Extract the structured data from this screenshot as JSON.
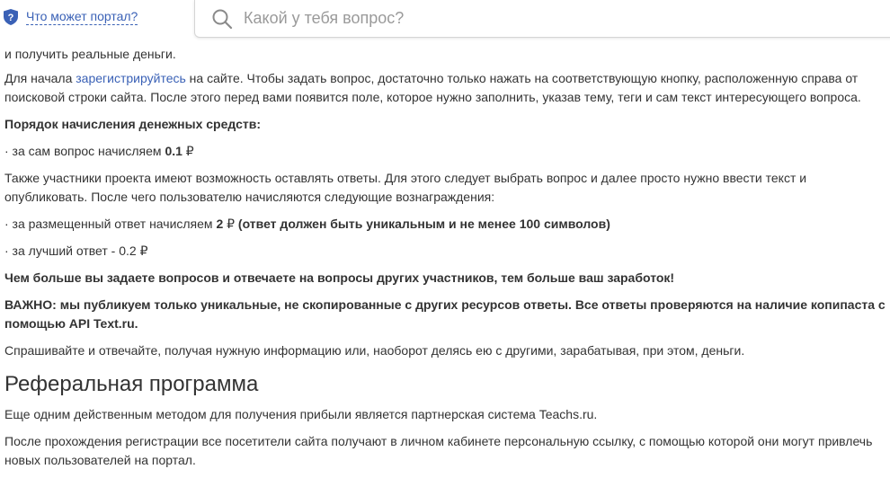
{
  "header": {
    "portal_link_label": "Что может портал?",
    "search_placeholder": "Какой у тебя вопрос?",
    "accent_color": "#3a61b6"
  },
  "article": {
    "partial_line": "и получить реальные деньги.",
    "p1_before": "Для начала ",
    "p1_link": "зарегистрируйтесь",
    "p1_after": " на сайте. Чтобы задать вопрос, достаточно только нажать на соответствующую кнопку, расположенную справа от поисковой строки сайта. После этого перед вами появится поле, которое нужно заполнить, указав тему, теги и сам текст интересующего вопроса.",
    "accrual_heading": "Порядок начисления денежных средств:",
    "item1_text": "· за сам вопрос начисляем ",
    "item1_value": "0.1",
    "item1_currency": " ₽",
    "p2": "Также участники проекта имеют возможность оставлять ответы. Для этого следует выбрать вопрос и далее просто нужно ввести текст и опубликовать. После чего пользователю начисляются следующие вознаграждения:",
    "item2_text": "· за размещенный ответ начисляем ",
    "item2_value": "2",
    "item2_currency": " ₽",
    "item2_note": " (ответ должен быть уникальным и не менее 100 символов)",
    "item3_text": "· за лучший ответ - 0.2 ₽",
    "bold_cta": "Чем больше вы задаете вопросов и отвечаете на вопросы других участников, тем больше ваш заработок!",
    "important": "ВАЖНО: мы публикуем только уникальные, не скопированные с других ресурсов ответы. Все ответы проверяются на наличие копипаста с помощью API Text.ru.",
    "p3": "Спрашивайте и отвечайте, получая нужную информацию или, наоборот делясь ею с другими, зарабатывая, при этом, деньги.",
    "referral_title": "Реферальная программа",
    "p4": "Еще одним действенным методом для получения прибыли является партнерская система Teachs.ru.",
    "p5": "После прохождения регистрации все посетители сайта получают в личном кабинете персональную ссылку, с помощью которой они могут привлечь новых пользователей на портал."
  }
}
